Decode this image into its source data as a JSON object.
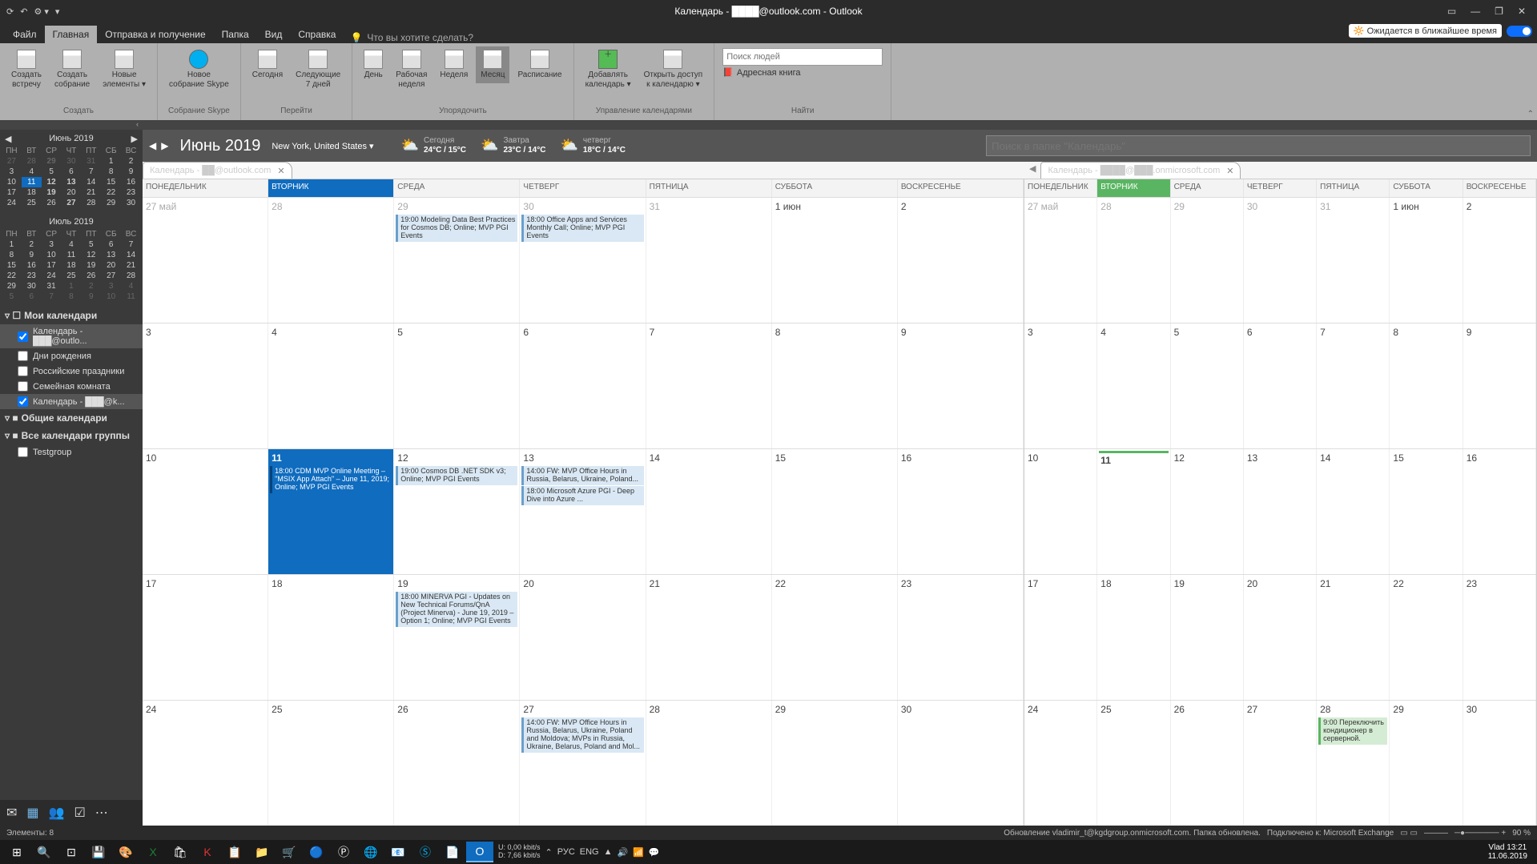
{
  "titlebar": {
    "title": "Календарь - ████@outlook.com - Outlook"
  },
  "menu": {
    "file": "Файл",
    "home": "Главная",
    "sendrecv": "Отправка и получение",
    "folder": "Папка",
    "view": "Вид",
    "help": "Справка",
    "tellme": "Что вы хотите сделать?",
    "expected": "Ожидается в ближайшее время"
  },
  "ribbon": {
    "new_appointment": "Создать\nвстречу",
    "new_meeting": "Создать\nсобрание",
    "new_items": "Новые\nэлементы ▾",
    "g_create": "Создать",
    "skype": "Новое\nсобрание Skype",
    "g_skype": "Собрание Skype",
    "today": "Сегодня",
    "next7": "Следующие\n7 дней",
    "g_goto": "Перейти",
    "day": "День",
    "workweek": "Рабочая\nнеделя",
    "week": "Неделя",
    "month": "Месяц",
    "schedule": "Расписание",
    "g_arr": "Упорядочить",
    "addcal": "Добавлять\nкалендарь ▾",
    "opencal": "Открыть доступ\nк календарю ▾",
    "g_mgr": "Управление календарями",
    "search_people": "Поиск людей",
    "addrbook": "Адресная книга",
    "g_find": "Найти"
  },
  "calheader": {
    "month": "Июнь 2019",
    "location": "New York, United States  ▾",
    "wx": [
      {
        "label": "Сегодня",
        "temp": "24°C / 15°C"
      },
      {
        "label": "Завтра",
        "temp": "23°C / 14°C"
      },
      {
        "label": "четверг",
        "temp": "18°C / 14°C"
      }
    ],
    "search_ph": "Поиск в папке \"Календарь\""
  },
  "sidebar": {
    "mini1": {
      "title": "Июнь 2019",
      "dows": [
        "ПН",
        "ВТ",
        "СР",
        "ЧТ",
        "ПТ",
        "СБ",
        "ВС"
      ],
      "rows": [
        [
          "27",
          "28",
          "29",
          "30",
          "31",
          "1",
          "2"
        ],
        [
          "3",
          "4",
          "5",
          "6",
          "7",
          "8",
          "9"
        ],
        [
          "10",
          "11",
          "12",
          "13",
          "14",
          "15",
          "16"
        ],
        [
          "17",
          "18",
          "19",
          "20",
          "21",
          "22",
          "23"
        ],
        [
          "24",
          "25",
          "26",
          "27",
          "28",
          "29",
          "30"
        ]
      ]
    },
    "mini2": {
      "title": "Июль 2019",
      "dows": [
        "ПН",
        "ВТ",
        "СР",
        "ЧТ",
        "ПТ",
        "СБ",
        "ВС"
      ],
      "rows": [
        [
          "1",
          "2",
          "3",
          "4",
          "5",
          "6",
          "7"
        ],
        [
          "8",
          "9",
          "10",
          "11",
          "12",
          "13",
          "14"
        ],
        [
          "15",
          "16",
          "17",
          "18",
          "19",
          "20",
          "21"
        ],
        [
          "22",
          "23",
          "24",
          "25",
          "26",
          "27",
          "28"
        ],
        [
          "29",
          "30",
          "31",
          "1",
          "2",
          "3",
          "4"
        ],
        [
          "5",
          "6",
          "7",
          "8",
          "9",
          "10",
          "11"
        ]
      ]
    },
    "sect_my": "Мои календари",
    "items_my": [
      {
        "label": "Календарь - ███@outlo...",
        "chk": true,
        "sel": true
      },
      {
        "label": "Дни рождения",
        "chk": false
      },
      {
        "label": "Российские праздники",
        "chk": false
      },
      {
        "label": "Семейная комната",
        "chk": false
      },
      {
        "label": "Календарь - ███@k...",
        "chk": true,
        "sel": true
      }
    ],
    "sect_shared": "Общие календари",
    "sect_group": "Все календари группы",
    "items_group": [
      {
        "label": "Testgroup",
        "chk": false
      }
    ]
  },
  "tabs": {
    "t1": "Календарь - ██@outlook.com",
    "t2": "Календарь - ████@███.onmicrosoft.com"
  },
  "dayheaders": [
    "ПОНЕДЕЛЬНИК",
    "ВТОРНИК",
    "СРЕДА",
    "ЧЕТВЕРГ",
    "ПЯТНИЦА",
    "СУББОТА",
    "ВОСКРЕСЕНЬЕ"
  ],
  "grid": {
    "weeks": [
      {
        "days": [
          "27 май",
          "28",
          "29",
          "30",
          "31",
          "1 июн",
          "2"
        ],
        "events": {
          "2": [
            {
              "t": "19:00 Modeling Data Best Practices for Cosmos DB; Online; MVP PGI Events"
            }
          ],
          "3": [
            {
              "t": "18:00 Office Apps and Services Monthly Call; Online; MVP PGI Events"
            }
          ]
        }
      },
      {
        "days": [
          "3",
          "4",
          "5",
          "6",
          "7",
          "8",
          "9"
        ]
      },
      {
        "days": [
          "10",
          "11",
          "12",
          "13",
          "14",
          "15",
          "16"
        ],
        "events": {
          "1": [
            {
              "t": "18:00 CDM MVP Online Meeting – \"MSIX App Attach\" – June 11, 2019; Online; MVP PGI Events",
              "sel": true
            }
          ],
          "2": [
            {
              "t": "19:00 Cosmos DB .NET SDK v3; Online; MVP PGI Events"
            }
          ],
          "3": [
            {
              "t": "14:00 FW: MVP Office Hours in Russia, Belarus, Ukraine, Poland..."
            },
            {
              "t": "18:00 Microsoft Azure PGI - Deep Dive into Azure ..."
            }
          ]
        }
      },
      {
        "days": [
          "17",
          "18",
          "19",
          "20",
          "21",
          "22",
          "23"
        ],
        "events": {
          "2": [
            {
              "t": "18:00 MINERVA PGI - Updates on New Technical Forums/QnA (Project Minerva) - June 19, 2019 – Option 1; Online; MVP PGI Events"
            }
          ]
        }
      },
      {
        "days": [
          "24",
          "25",
          "26",
          "27",
          "28",
          "29",
          "30"
        ],
        "events": {
          "3": [
            {
              "t": "14:00 FW: MVP Office Hours in Russia, Belarus, Ukraine, Poland and Moldova; MVPs in Russia, Ukraine, Belarus, Poland and Mol..."
            }
          ]
        }
      }
    ]
  },
  "grid2": {
    "weeks": [
      {
        "days": [
          "27 май",
          "28",
          "29",
          "30",
          "31",
          "1 июн",
          "2"
        ]
      },
      {
        "days": [
          "3",
          "4",
          "5",
          "6",
          "7",
          "8",
          "9"
        ]
      },
      {
        "days": [
          "10",
          "11",
          "12",
          "13",
          "14",
          "15",
          "16"
        ]
      },
      {
        "days": [
          "17",
          "18",
          "19",
          "20",
          "21",
          "22",
          "23"
        ]
      },
      {
        "days": [
          "24",
          "25",
          "26",
          "27",
          "28",
          "29",
          "30"
        ],
        "events": {
          "4": [
            {
              "t": "9:00 Переключить кондиционер в серверной.",
              "g": true
            }
          ]
        }
      }
    ]
  },
  "status": {
    "items": "Элементы: 8",
    "update": "Обновление vladimir_t@kgdgroup.onmicrosoft.com.   Папка обновлена.",
    "conn": "Подключено к: Microsoft Exchange",
    "zoom": "90 %"
  },
  "taskbar": {
    "net_u": "U:    0,00 kbit/s",
    "net_d": "D:    7,66 kbit/s",
    "user": "Vlad",
    "time": "13:21",
    "date": "11.06.2019",
    "lang": "РУС",
    "lang2": "ENG"
  }
}
